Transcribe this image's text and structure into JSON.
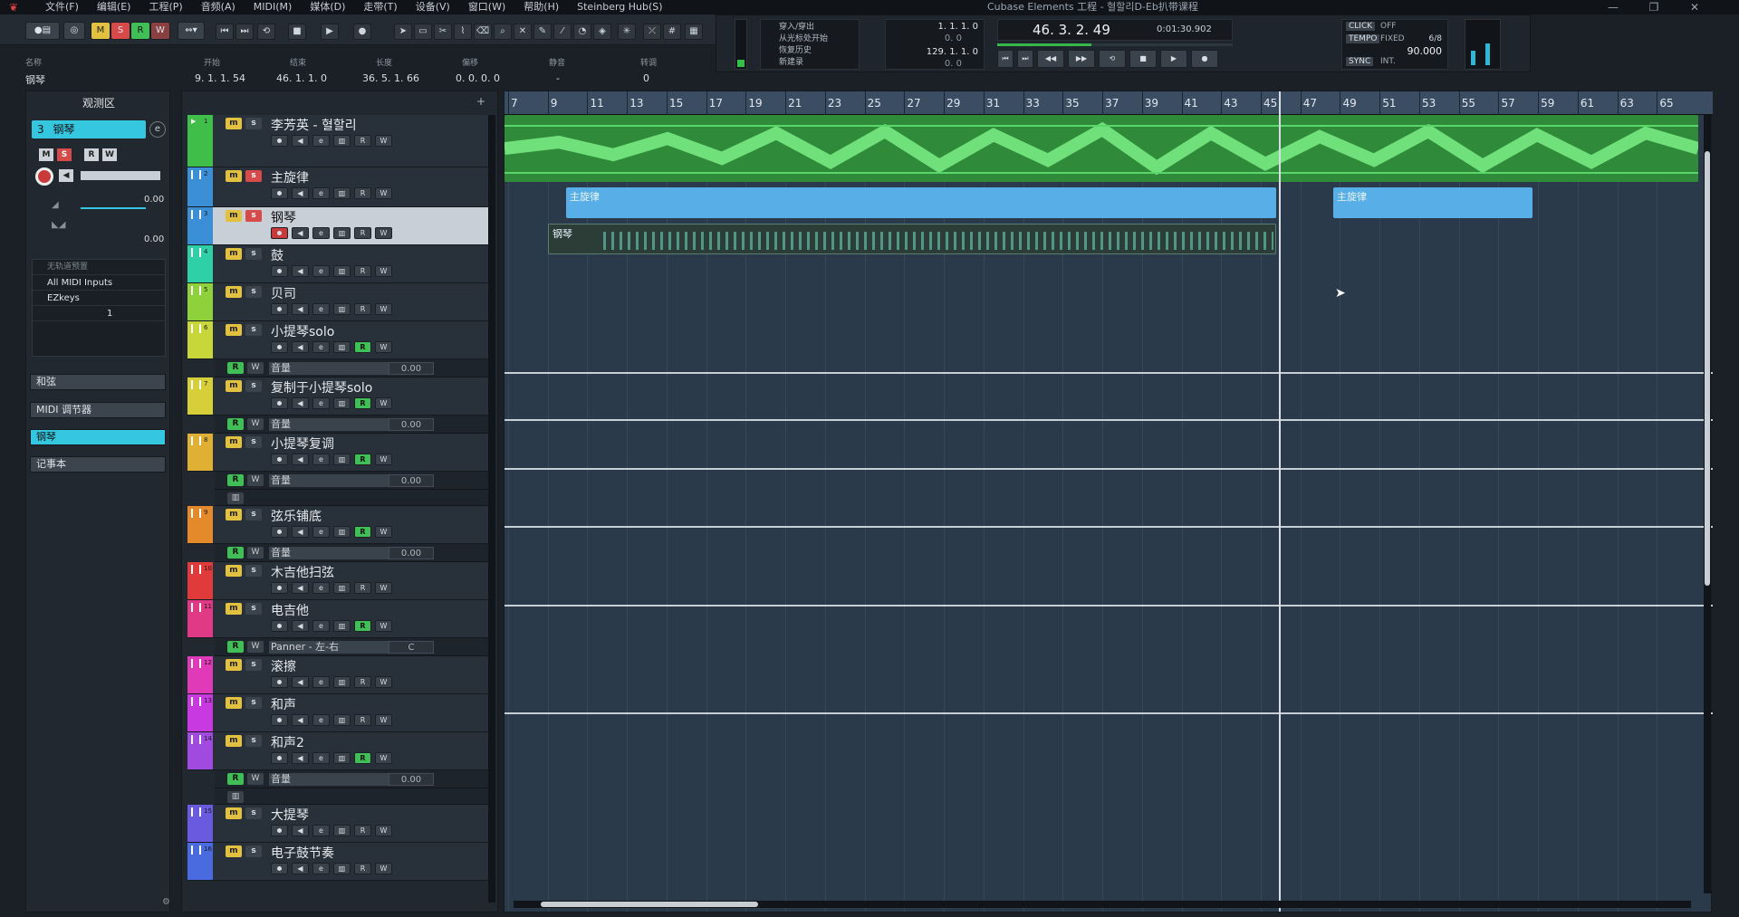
{
  "menubar": {
    "items": [
      "文件(F)",
      "编辑(E)",
      "工程(P)",
      "音频(A)",
      "MIDI(M)",
      "媒体(D)",
      "走带(T)",
      "设备(V)",
      "窗口(W)",
      "帮助(H)",
      "Steinberg Hub(S)"
    ],
    "window_title": "Cubase Elements 工程 - 혈할리D-Eb扒带课程"
  },
  "toolbar": {
    "msrw": [
      "M",
      "S",
      "R",
      "W"
    ]
  },
  "infoline": {
    "headers": [
      "名称",
      "开始",
      "结束",
      "长度",
      "偏移",
      "静音",
      "转调"
    ],
    "values": [
      "钢琴",
      "9. 1. 1. 54",
      "46. 1. 1. 0",
      "36. 5. 1. 66",
      "0. 0. 0. 0",
      "-",
      "0"
    ]
  },
  "transport": {
    "markers": [
      "穿入/穿出",
      "从光标处开始",
      "恢复历史",
      "新建录"
    ],
    "left_locator": "1. 1. 1. 0",
    "left_sub": "0. 0",
    "right_locator": "129. 1. 1. 0",
    "right_sub": "0. 0",
    "position": "46. 3. 2. 49",
    "time": "0:01:30.902",
    "click": "CLICK",
    "click_state": "OFF",
    "tempo_label": "TEMPO",
    "tempo_mode": "FIXED",
    "signature": "6/8",
    "tempo": "90.000",
    "sync": "SYNC",
    "sync_mode": "INT."
  },
  "inspector": {
    "title": "观测区",
    "track_label": "钢琴",
    "track_num": "3",
    "volume_val": "0.00",
    "pan_val": "0.00",
    "routing": [
      "无轨道预置",
      "All MIDI Inputs",
      "EZkeys"
    ],
    "channel": "1",
    "sections": [
      "和弦",
      "MIDI 调节器",
      "钢琴",
      "记事本"
    ]
  },
  "tracks": [
    {
      "num": "1",
      "name": "李芳英 - 혈할리",
      "color": "#3fbf4a",
      "type": "audio"
    },
    {
      "num": "2",
      "name": "主旋律",
      "color": "#3a8fd6",
      "type": "midi"
    },
    {
      "num": "3",
      "name": "钢琴",
      "color": "#3a8fd6",
      "type": "midi"
    },
    {
      "num": "4",
      "name": "鼓",
      "color": "#2fcfa8",
      "type": "midi"
    },
    {
      "num": "5",
      "name": "贝司",
      "color": "#8fd13a",
      "type": "midi"
    },
    {
      "num": "6",
      "name": "小提琴solo",
      "color": "#c7d73a",
      "type": "midi"
    },
    {
      "num": "7",
      "name": "复制于小提琴solo",
      "color": "#d7cf3a",
      "type": "midi"
    },
    {
      "num": "8",
      "name": "小提琴复调",
      "color": "#e0b035",
      "type": "midi"
    },
    {
      "num": "9",
      "name": "弦乐铺底",
      "color": "#e58a2a",
      "type": "midi"
    },
    {
      "num": "10",
      "name": "木吉他扫弦",
      "color": "#e03a3a",
      "type": "midi"
    },
    {
      "num": "11",
      "name": "电吉他",
      "color": "#e03a86",
      "type": "midi"
    },
    {
      "num": "12",
      "name": "滚擦",
      "color": "#e03ab8",
      "type": "midi"
    },
    {
      "num": "13",
      "name": "和声",
      "color": "#c83ae0",
      "type": "midi"
    },
    {
      "num": "14",
      "name": "和声2",
      "color": "#a04ae0",
      "type": "midi"
    },
    {
      "num": "15",
      "name": "大提琴",
      "color": "#6a5ae0",
      "type": "midi"
    },
    {
      "num": "16",
      "name": "电子鼓节奏",
      "color": "#4a6ae0",
      "type": "midi"
    }
  ],
  "lanes": {
    "volume": "音量",
    "panner": "Panner - 左-右",
    "volume_val": "0.00",
    "panner_val": "C"
  },
  "ruler": [
    "7",
    "9",
    "11",
    "13",
    "15",
    "17",
    "19",
    "21",
    "23",
    "25",
    "27",
    "29",
    "31",
    "33",
    "35",
    "37",
    "39",
    "41",
    "43",
    "45",
    "47",
    "49",
    "51",
    "53",
    "55",
    "57",
    "59",
    "61",
    "63",
    "65"
  ],
  "parts": {
    "melody1": "主旋律",
    "melody2": "主旋律",
    "piano": "钢琴"
  }
}
